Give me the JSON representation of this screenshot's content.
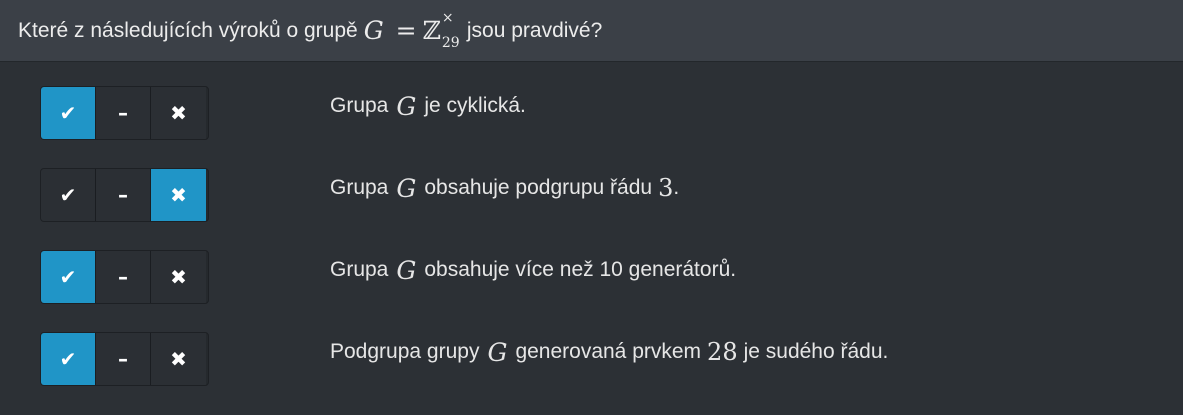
{
  "question": {
    "prefix": "Které z následujících výroků o grupě",
    "group_symbol": "G",
    "equals": "=",
    "set_symbol": "ℤ",
    "set_sup": "×",
    "set_sub": "29",
    "suffix": "jsou pravdivé?"
  },
  "buttons": {
    "true_glyph": "✔",
    "neutral_glyph": "–",
    "false_glyph": "✖"
  },
  "statements": [
    {
      "before": "Grupa",
      "sym": "G",
      "after": "je cyklická.",
      "num": "",
      "tail": "",
      "selected": "true"
    },
    {
      "before": "Grupa",
      "sym": "G",
      "after": "obsahuje podgrupu řádu",
      "num": "3",
      "tail": ".",
      "selected": "false"
    },
    {
      "before": "Grupa",
      "sym": "G",
      "after": "obsahuje více než 10 generátorů.",
      "num": "",
      "tail": "",
      "selected": "true"
    },
    {
      "before": "Podgrupa grupy",
      "sym": "G",
      "after": "generovaná prvkem",
      "num": "28",
      "tail": "je sudého řádu.",
      "selected": "true"
    }
  ],
  "colors": {
    "active": "#2095c7",
    "background": "#2c3035",
    "header": "#3b4047"
  }
}
